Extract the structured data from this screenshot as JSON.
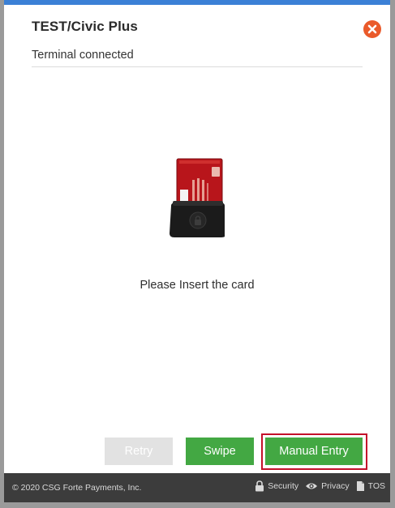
{
  "dialog": {
    "title": "TEST/Civic Plus",
    "status": "Terminal connected",
    "instruction": "Please Insert the card",
    "accent_color": "#3b80d6",
    "close_icon": "close-icon"
  },
  "card_reader": {
    "icon": "card-reader-icon"
  },
  "actions": {
    "retry_label": "Retry",
    "swipe_label": "Swipe",
    "manual_entry_label": "Manual Entry",
    "primary_color": "#43a843",
    "disabled_color": "#e2e2e2",
    "highlight_color": "#c4102a"
  },
  "footer": {
    "copyright": "© 2020 CSG Forte Payments, Inc.",
    "links": {
      "security": "Security",
      "privacy": "Privacy",
      "tos": "TOS"
    }
  }
}
